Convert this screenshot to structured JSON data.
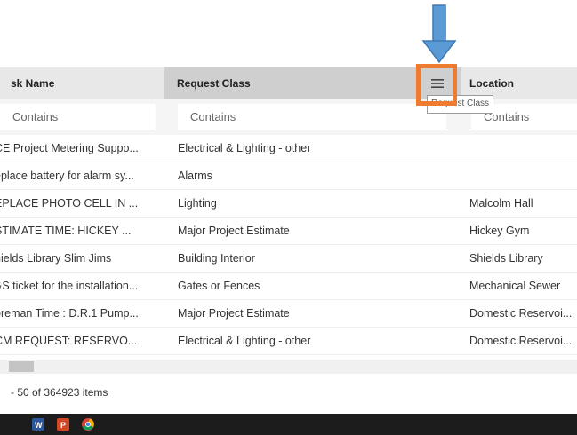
{
  "columns": {
    "task_name": "sk Name",
    "request_class": "Request Class",
    "location": "Location"
  },
  "filters": {
    "placeholder": "Contains"
  },
  "tooltip": "Request Class",
  "rows": [
    {
      "task": "CE Project Metering Suppo...",
      "class": "Electrical & Lighting - other",
      "location": ""
    },
    {
      "task": "eplace battery for alarm sy...",
      "class": "Alarms",
      "location": ""
    },
    {
      "task": "EPLACE PHOTO CELL IN ...",
      "class": "Lighting",
      "location": "Malcolm Hall"
    },
    {
      "task": "STIMATE TIME: HICKEY ...",
      "class": "Major Project Estimate",
      "location": "Hickey Gym"
    },
    {
      "task": "hields Library Slim Jims",
      "class": "Building Interior",
      "location": "Shields Library"
    },
    {
      "task": "&S ticket for the installation...",
      "class": "Gates or Fences",
      "location": "Mechanical Sewer"
    },
    {
      "task": "oreman Time : D.R.1 Pump...",
      "class": "Major Project Estimate",
      "location": "Domestic Reservoi..."
    },
    {
      "task": "CM REQUEST: RESERVO...",
      "class": "Electrical & Lighting - other",
      "location": "Domestic Reservoi..."
    }
  ],
  "pager": "- 50 of 364923 items",
  "icons": {
    "menu": "hamburger-menu-icon",
    "arrow": "down-arrow-annotation",
    "taskbar": [
      "word-icon",
      "powerpoint-icon",
      "chrome-icon"
    ]
  },
  "colors": {
    "highlight": "#ee7b30",
    "arrow": "#5b9bd5",
    "header_active": "#cfcfcf",
    "header": "#e8e8e8"
  }
}
